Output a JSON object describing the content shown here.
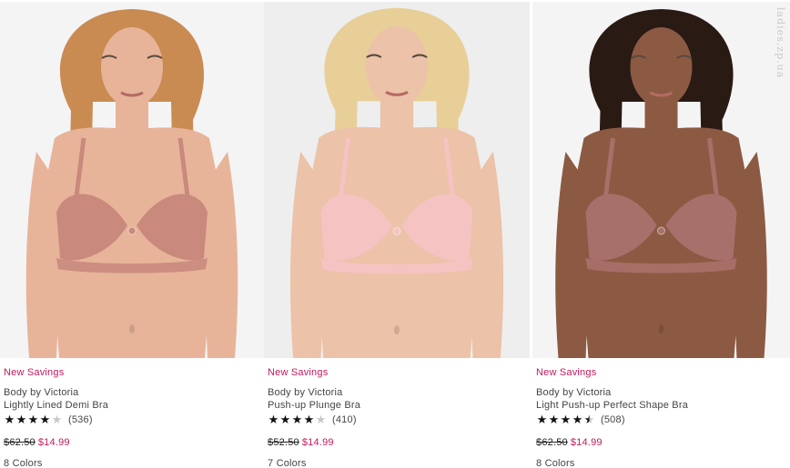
{
  "watermark": "ladies.zp.ua",
  "products": [
    {
      "badge": "New Savings",
      "brand": "Body by Victoria",
      "name": "Lightly Lined Demi Bra",
      "rating": 4,
      "reviews": "(536)",
      "old_price": "$62.50",
      "sale_price": "$14.99",
      "colors": "8 Colors",
      "bra_color": "#c98a7d",
      "skin_color": "#e7b49a",
      "hair_color": "#c98b52",
      "bg_color": "#f4f4f4"
    },
    {
      "badge": "New Savings",
      "brand": "Body by Victoria",
      "name": "Push-up Plunge Bra",
      "rating": 4,
      "reviews": "(410)",
      "old_price": "$52.50",
      "sale_price": "$14.99",
      "colors": "7 Colors",
      "bra_color": "#f6c3c3",
      "skin_color": "#ecc2a8",
      "hair_color": "#e8cf98",
      "bg_color": "#eeeeee"
    },
    {
      "badge": "New Savings",
      "brand": "Body by Victoria",
      "name": "Light Push-up Perfect Shape Bra",
      "rating": 4.5,
      "reviews": "(508)",
      "old_price": "$62.50",
      "sale_price": "$14.99",
      "colors": "8 Colors",
      "bra_color": "#a8706a",
      "skin_color": "#8c5a43",
      "hair_color": "#2a1a14",
      "bg_color": "#f4f4f4"
    }
  ]
}
